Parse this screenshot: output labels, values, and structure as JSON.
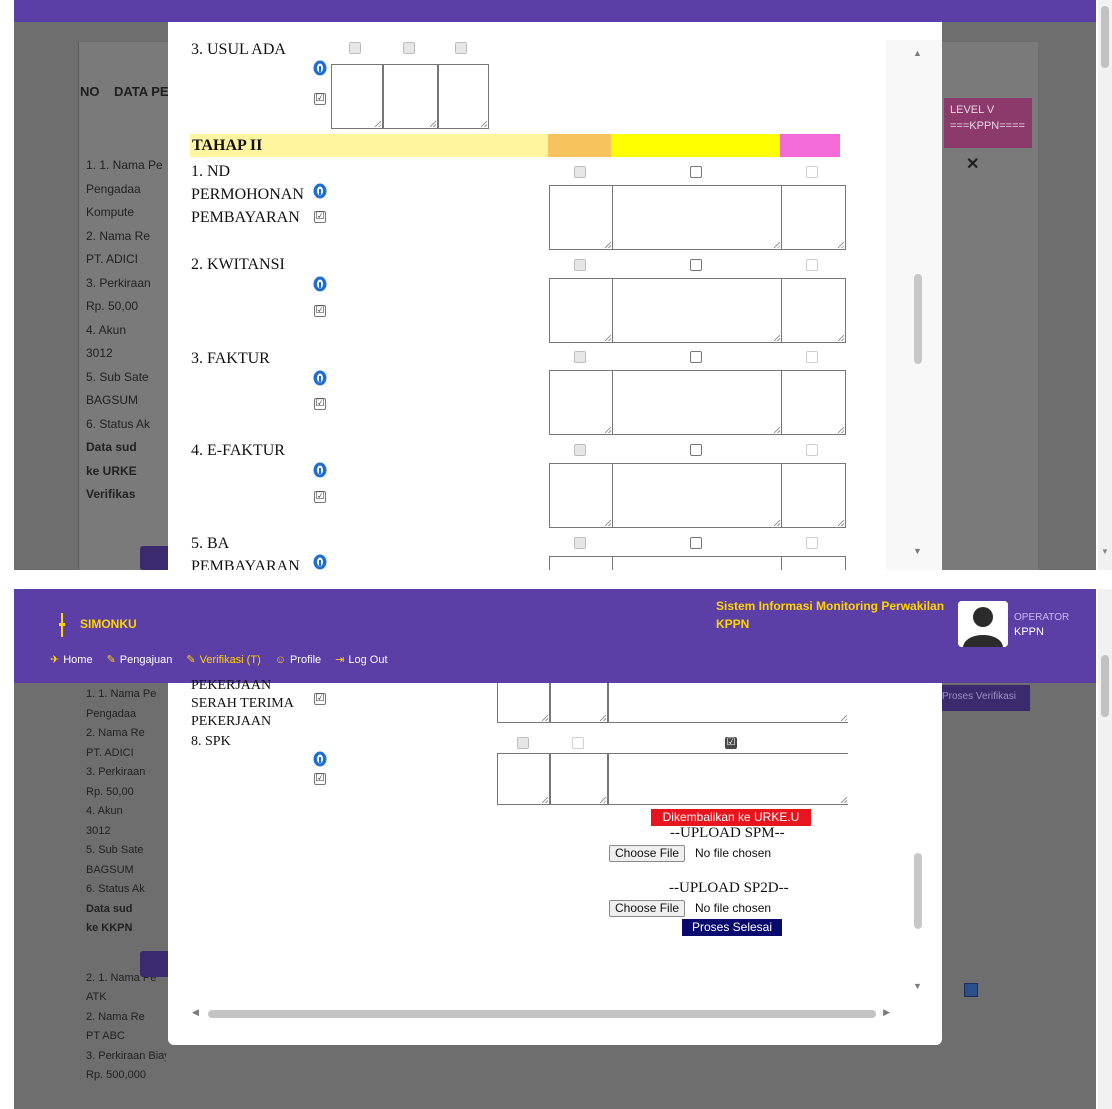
{
  "panel1": {
    "table_header": {
      "no": "NO",
      "data": "DATA PE"
    },
    "level_header": {
      "line1": "LEVEL V",
      "line2": "===KPPN===="
    },
    "reject_mark": "✕",
    "row_lines": [
      "1. 1. Nama Pe",
      "Pengadaa",
      "Kompute",
      "2. Nama Re",
      "PT. ADICI",
      "3. Perkiraan",
      "Rp. 50,00",
      "4. Akun",
      "3012",
      "5. Sub Sate",
      "BAGSUM",
      "6. Status Ak"
    ],
    "row_bold_lines": [
      "Data sud",
      "ke URKE",
      "Verifikas"
    ],
    "modal": {
      "usul_ada": "3. USUL ADA",
      "tahap_title": "TAHAP II",
      "items": [
        {
          "label_lines": [
            "1. ND",
            "PERMOHONAN",
            "PEMBAYARAN"
          ]
        },
        {
          "label_lines": [
            "2. KWITANSI"
          ]
        },
        {
          "label_lines": [
            "3. FAKTUR"
          ]
        },
        {
          "label_lines": [
            "4. E-FAKTUR"
          ]
        },
        {
          "label_lines": [
            "5. BA",
            "PEMBAYARAN"
          ]
        }
      ],
      "checkmark": "☑"
    }
  },
  "panel2": {
    "nav": {
      "brand": "SIMONKU",
      "system_name_line1": "Sistem Informasi Monitoring Perwakilan",
      "system_name_line2": "KPPN",
      "user_role": "OPERATOR",
      "user_name": "KPPN",
      "menu": [
        {
          "icon": "✈",
          "label": "Home"
        },
        {
          "icon": "✎",
          "label": "Pengajuan"
        },
        {
          "icon": "✎",
          "label": "Verifikasi (T)"
        },
        {
          "icon": "☺",
          "label": "Profile"
        },
        {
          "icon": "⇥",
          "label": "Log Out"
        }
      ]
    },
    "verif_button": "Proses Verifikasi",
    "row_lines": [
      "1. 1. Nama Pe",
      "Pengadaa",
      "2. Nama Re",
      "PT. ADICI",
      "3. Perkiraan",
      "Rp. 50,00",
      "4. Akun",
      "3012",
      "5. Sub Sate",
      "BAGSUM",
      "6. Status Ak"
    ],
    "row_bold_lines": [
      "Data sud",
      "ke KKPN"
    ],
    "row2_lines": [
      "2. 1. Nama Pe",
      "ATK",
      "2. Nama Re",
      "PT ABC",
      "3. Perkiraan Biaya",
      "Rp. 500,000"
    ],
    "modal": {
      "pekerjaan": "PEKERJAAN",
      "serah_terima_lines": [
        "SERAH TERIMA",
        "PEKERJAAN"
      ],
      "spk": "8. SPK",
      "return_button": "Dikembalikan ke URKE.U",
      "upload_spm": "--UPLOAD SPM--",
      "upload_sp2d": "--UPLOAD SP2D--",
      "choose_file": "Choose File",
      "no_file": "No file chosen",
      "finish_button": "Proses Selesai",
      "checkmark": "☑"
    }
  }
}
